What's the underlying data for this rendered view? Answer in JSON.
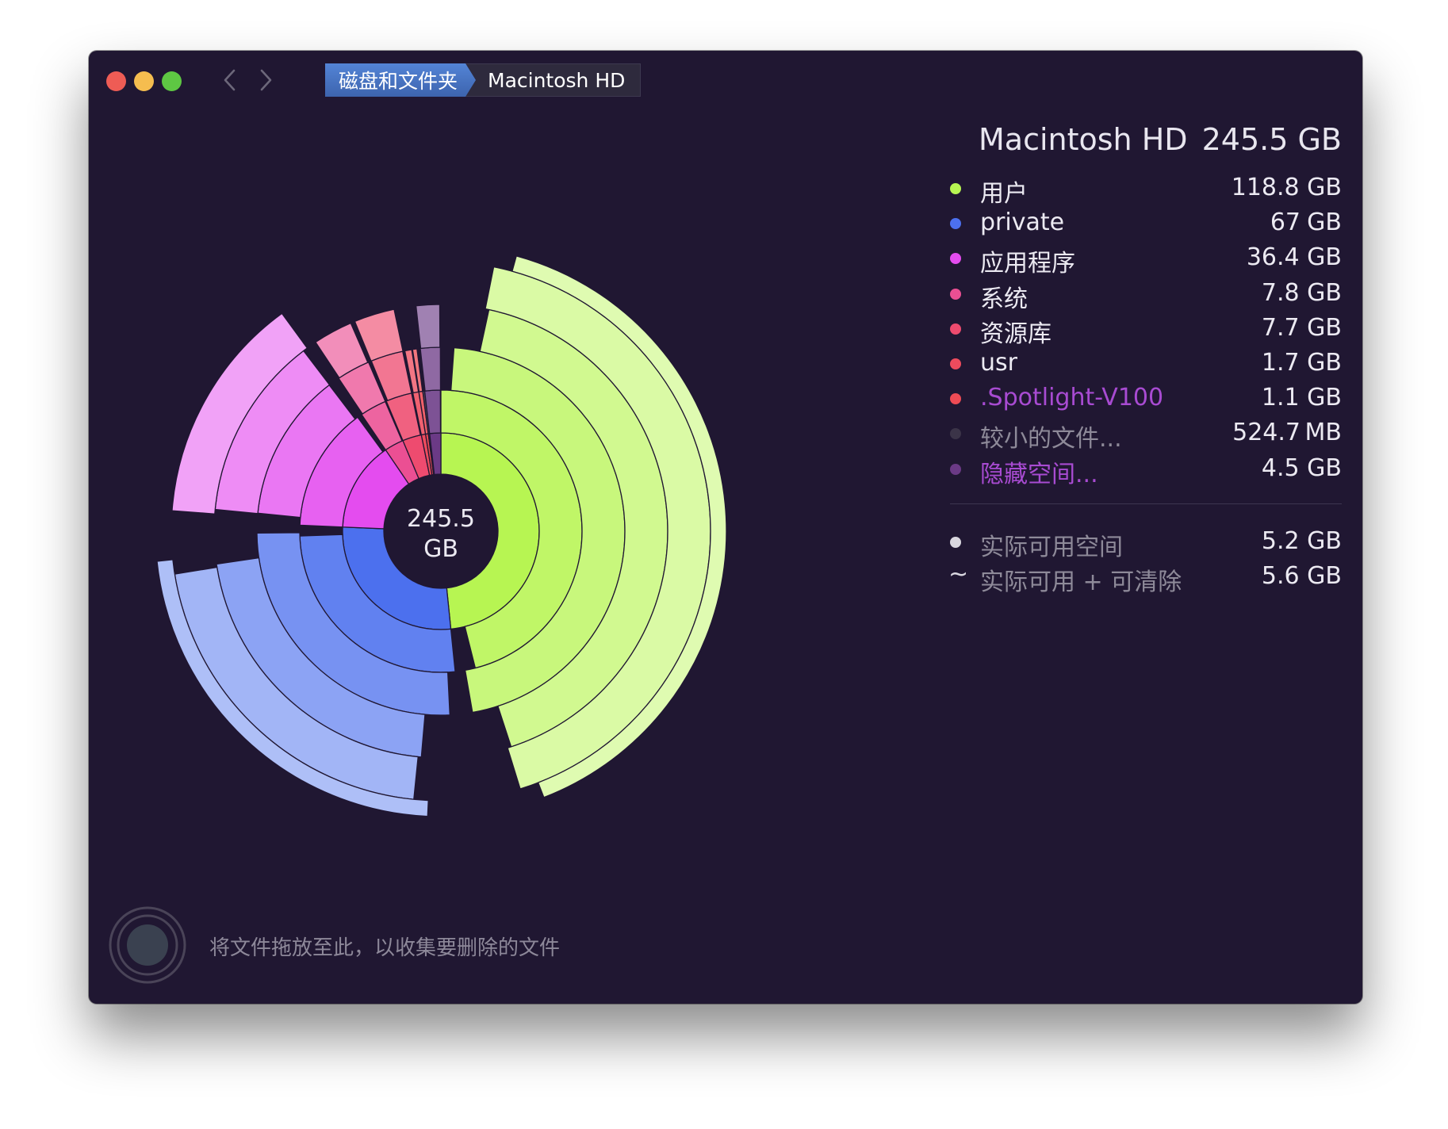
{
  "window": {
    "traffic_colors": [
      "#ee5c55",
      "#f5bd4f",
      "#5ec743"
    ]
  },
  "breadcrumb": {
    "items": [
      "磁盘和文件夹",
      "Macintosh HD"
    ]
  },
  "disk": {
    "name": "Macintosh HD",
    "total": "245.5 GB",
    "center_value": "245.5",
    "center_unit": "GB"
  },
  "legend": [
    {
      "label": "用户",
      "value": "118.8 GB",
      "color": "#b7f552",
      "label_color": "#eceaf2"
    },
    {
      "label": "private",
      "value": "67",
      "unit": "GB",
      "color": "#4c70ee",
      "label_color": "#eceaf2"
    },
    {
      "label": "应用程序",
      "value": "36.4 GB",
      "color": "#e44cef",
      "label_color": "#eceaf2"
    },
    {
      "label": "系统",
      "value": "7.8 GB",
      "color": "#eb4f93",
      "label_color": "#eceaf2"
    },
    {
      "label": "资源库",
      "value": "7.7 GB",
      "color": "#ee4b6f",
      "label_color": "#eceaf2"
    },
    {
      "label": "usr",
      "value": "1.7 GB",
      "color": "#ee4b5d",
      "label_color": "#eceaf2"
    },
    {
      "label": ".Spotlight-V100",
      "value": "1.1 GB",
      "color": "#ee4b55",
      "label_color": "#a84bd2"
    },
    {
      "label": "较小的文件...",
      "value": "524.7",
      "unit": "MB",
      "color": "#3b3448",
      "label_color": "#8e8a99"
    },
    {
      "label": "隐藏空间...",
      "value": "4.5 GB",
      "color": "#6b3a86",
      "label_color": "#a84bd2"
    }
  ],
  "space": [
    {
      "icon": "dot",
      "label": "实际可用空间",
      "value": "5.2 GB"
    },
    {
      "icon": "tilde",
      "symbol": "~",
      "label": "实际可用 + 可清除",
      "value": "5.6 GB"
    }
  ],
  "drop_zone": {
    "text": "将文件拖放至此，以收集要删除的文件"
  },
  "chart_data": {
    "type": "sunburst",
    "unit": "GB",
    "total": 245.5,
    "segments": [
      {
        "name": "用户",
        "value": 118.8,
        "color": "#b7f552"
      },
      {
        "name": "private",
        "value": 67,
        "color": "#4c70ee"
      },
      {
        "name": "应用程序",
        "value": 36.4,
        "color": "#e44cef"
      },
      {
        "name": "系统",
        "value": 7.8,
        "color": "#eb4f93"
      },
      {
        "name": "资源库",
        "value": 7.7,
        "color": "#ee4b6f"
      },
      {
        "name": "usr",
        "value": 1.7,
        "color": "#ee4b5d"
      },
      {
        "name": ".Spotlight-V100",
        "value": 1.1,
        "color": "#ee4b55"
      },
      {
        "name": "较小的文件...",
        "value": 0.5247,
        "color": "#3b3448"
      },
      {
        "name": "隐藏空间...",
        "value": 4.5,
        "color": "#6b3a86"
      }
    ]
  }
}
